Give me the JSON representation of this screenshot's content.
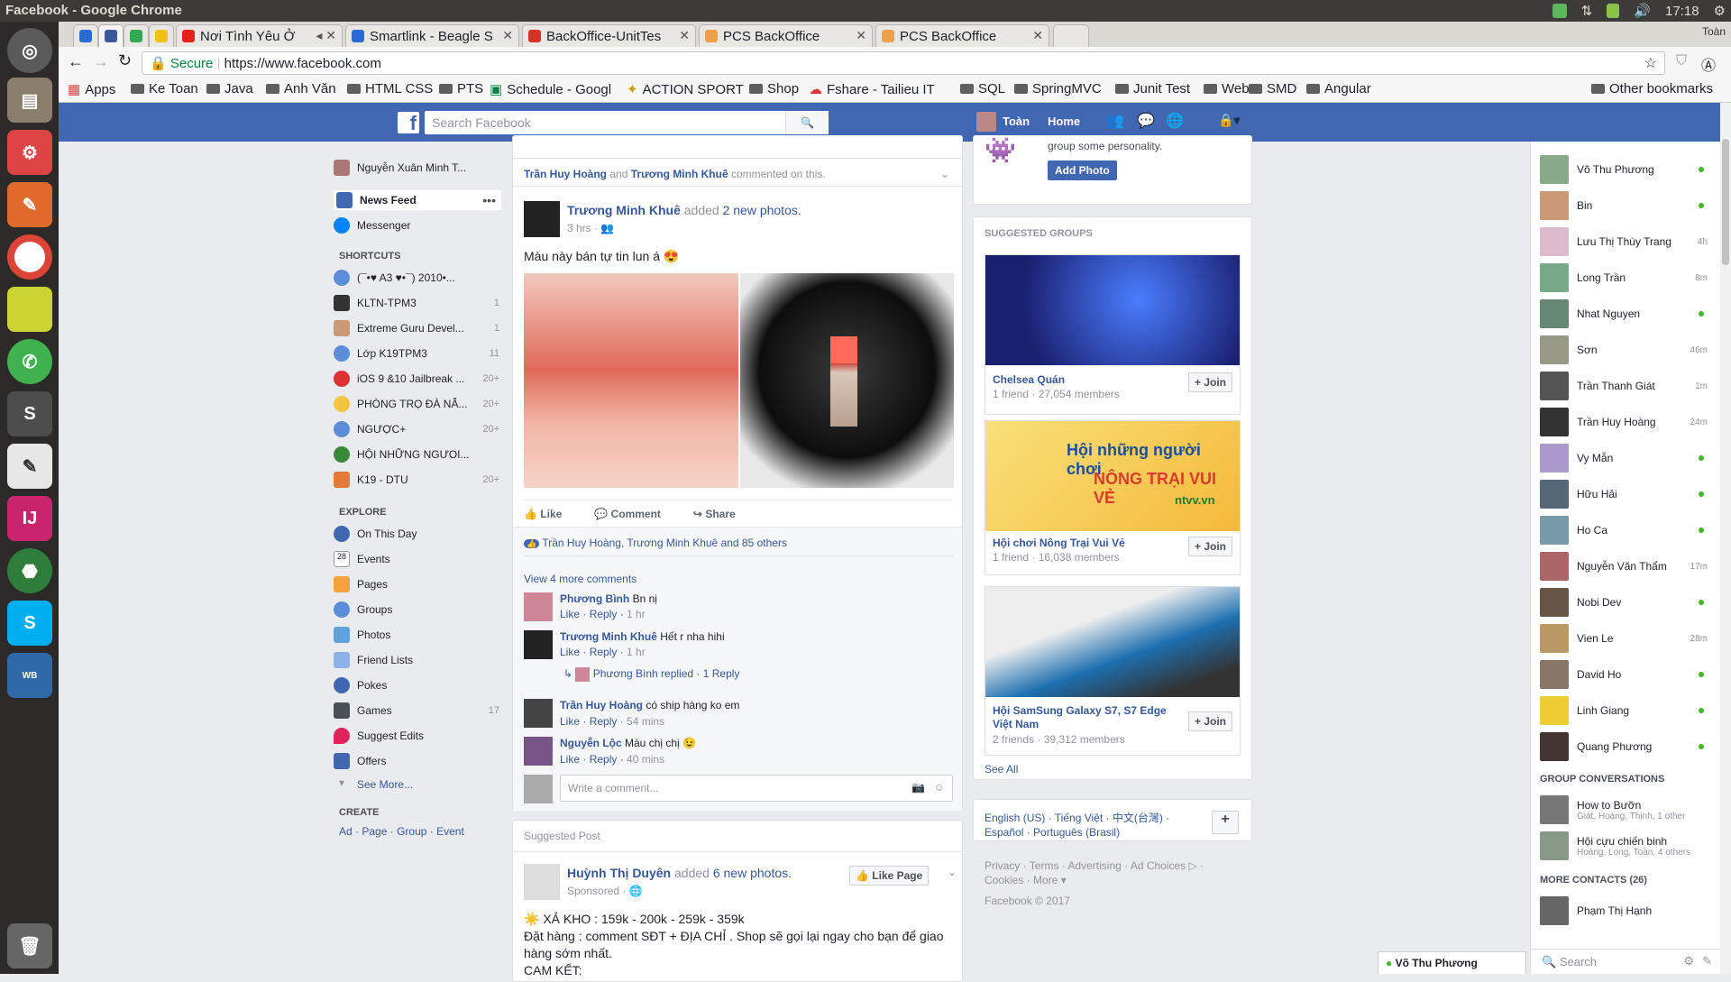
{
  "os": {
    "title": "Facebook - Google Chrome",
    "clock": "17:18",
    "user": "Toàn"
  },
  "tabs": [
    {
      "label": ""
    },
    {
      "label": ""
    },
    {
      "label": ""
    },
    {
      "label": ""
    },
    {
      "label": "Nơi Tình Yêu Ở"
    },
    {
      "label": "Smartlink - Beagle S"
    },
    {
      "label": "BackOffice-UnitTes"
    },
    {
      "label": "PCS BackOffice"
    },
    {
      "label": "PCS BackOffice"
    }
  ],
  "omnibox": {
    "secure": "Secure",
    "url": "https://www.facebook.com"
  },
  "bookmarks": [
    "Apps",
    "Ke Toan",
    "Java",
    "Anh Văn",
    "HTML CSS",
    "PTS",
    "Schedule - Googl",
    "ACTION SPORT",
    "Shop",
    "Fshare - Tailieu IT",
    "SQL",
    "SpringMVC",
    "Junit Test",
    "Web",
    "SMD",
    "Angular"
  ],
  "other_bookmarks": "Other bookmarks",
  "fb": {
    "search_placeholder": "Search Facebook",
    "user": "Toàn",
    "home": "Home"
  },
  "left": {
    "profile": "Nguyễn Xuân Minh T...",
    "newsfeed": "News Feed",
    "messenger": "Messenger",
    "shortcuts_title": "SHORTCUTS",
    "shortcuts": [
      {
        "label": "(¯•♥ A3 ♥•¯) 2010•...",
        "count": ""
      },
      {
        "label": "KLTN-TPM3",
        "count": "1"
      },
      {
        "label": "Extreme Guru Devel...",
        "count": "1"
      },
      {
        "label": "Lớp K19TPM3",
        "count": "11"
      },
      {
        "label": "iOS 9 &10 Jailbreak ...",
        "count": "20+"
      },
      {
        "label": "PHÒNG TRỌ ĐÀ NẴ...",
        "count": "20+"
      },
      {
        "label": "NGƯỢC+",
        "count": "20+"
      },
      {
        "label": "HỘI NHỮNG NGƯOI...",
        "count": ""
      },
      {
        "label": "K19 - DTU",
        "count": "20+"
      }
    ],
    "explore_title": "EXPLORE",
    "explore": [
      {
        "label": "On This Day",
        "count": ""
      },
      {
        "label": "Events",
        "count": ""
      },
      {
        "label": "Pages",
        "count": ""
      },
      {
        "label": "Groups",
        "count": ""
      },
      {
        "label": "Photos",
        "count": ""
      },
      {
        "label": "Friend Lists",
        "count": ""
      },
      {
        "label": "Pokes",
        "count": ""
      },
      {
        "label": "Games",
        "count": "17"
      },
      {
        "label": "Suggest Edits",
        "count": ""
      },
      {
        "label": "Offers",
        "count": ""
      },
      {
        "label": "See More...",
        "count": ""
      }
    ],
    "create_title": "CREATE",
    "create": [
      "Ad",
      "Page",
      "Group",
      "Event"
    ]
  },
  "post1": {
    "context_a": "Trần Huy Hoàng",
    "context_and": "and",
    "context_b": "Trương Minh Khuê",
    "context_rest": "commented on this.",
    "author": "Trương Minh Khuê",
    "action": "added",
    "action_link": "2 new photos.",
    "time": "3 hrs ·",
    "text": "Màu này bán tự tin lun á 😍",
    "like": "Like",
    "comment": "Comment",
    "share": "Share",
    "reactions": "Trần Huy Hoàng, Trương Minh Khuê and 85 others",
    "view_more": "View 4 more comments",
    "comments": [
      {
        "name": "Phương Bình",
        "text": "Bn nị",
        "time": "1 hr"
      },
      {
        "name": "Trương Minh Khuê",
        "text": "Hết r nha hihi",
        "time": "1 hr"
      },
      {
        "name": "Trần Huy Hoàng",
        "text": "có ship hàng ko em",
        "time": "54 mins"
      },
      {
        "name": "Nguyễn Lộc",
        "text": "Màu chị chị 😉",
        "time": "40 mins"
      }
    ],
    "reply_name": "Phương Bình",
    "reply_text": "replied · 1 Reply",
    "c_like": "Like",
    "c_reply": "Reply",
    "write": "Write a comment..."
  },
  "post2": {
    "label": "Suggested Post",
    "author": "Huỳnh Thị Duyên",
    "action": "added",
    "action_link": "6 new photos.",
    "sponsored": "Sponsored ·",
    "like_page": "Like Page",
    "line1": "☀️ XẢ KHO : 159k - 200k - 259k - 359k",
    "line2": "Đặt hàng : comment SĐT + ĐỊA CHỈ . Shop sẽ gọi lại ngay cho bạn để giao",
    "line3": "hàng sớm nhất.",
    "line4": "CAM KẾT:"
  },
  "rightmid": {
    "personality": "group some personality.",
    "add_photo": "Add Photo",
    "suggested_title": "SUGGESTED GROUPS",
    "groups": [
      {
        "name": "Chelsea Quán",
        "meta": "1 friend · 27,054 members",
        "join": "Join",
        "colors": [
          "#1a1f6e",
          "#4a7dff"
        ]
      },
      {
        "name": "Hội chơi Nông Trại Vui Vẻ",
        "meta": "1 friend · 16,038 members",
        "join": "Join",
        "colors": [
          "#f5c13a",
          "#d93b2f"
        ],
        "banner1": "Hội những người chơi",
        "banner2": "NÔNG TRẠI VUI VẺ",
        "banner3": "ntvv.vn"
      },
      {
        "name": "Hội SamSung Galaxy S7, S7 Edge Việt Nam",
        "meta": "2 friends · 39,312 members",
        "join": "Join",
        "colors": [
          "#e8e8e8",
          "#1d6fb0"
        ]
      }
    ],
    "see_all": "See All",
    "langs": "English (US) · Tiếng Việt · 中文(台灣) · Español · Português (Brasil)",
    "footer1": "Privacy · Terms · Advertising · Ad Choices ▷ ·",
    "footer2": "Cookies · More ▾",
    "copyright": "Facebook © 2017"
  },
  "chat": {
    "contacts": [
      {
        "name": "Võ Thu Phương",
        "status": "online",
        "time": ""
      },
      {
        "name": "Bin",
        "status": "online",
        "time": ""
      },
      {
        "name": "Lưu Thị Thùy Trang",
        "status": "away",
        "time": "4h"
      },
      {
        "name": "Long Trần",
        "status": "away",
        "time": "8m"
      },
      {
        "name": "Nhat Nguyen",
        "status": "online",
        "time": ""
      },
      {
        "name": "Sơn",
        "status": "away",
        "time": "46m"
      },
      {
        "name": "Trần Thanh Giát",
        "status": "away",
        "time": "1m"
      },
      {
        "name": "Trần Huy Hoàng",
        "status": "away",
        "time": "24m"
      },
      {
        "name": "Vy Mẫn",
        "status": "online",
        "time": ""
      },
      {
        "name": "Hữu Hải",
        "status": "online",
        "time": ""
      },
      {
        "name": "Ho Ca",
        "status": "online",
        "time": ""
      },
      {
        "name": "Nguyễn Văn Thẩm",
        "status": "away",
        "time": "17m"
      },
      {
        "name": "Nobi Dev",
        "status": "online",
        "time": ""
      },
      {
        "name": "Vien Le",
        "status": "away",
        "time": "28m"
      },
      {
        "name": "David Ho",
        "status": "online",
        "time": ""
      },
      {
        "name": "Linh Giang",
        "status": "online",
        "time": ""
      },
      {
        "name": "Quang Phương",
        "status": "online",
        "time": ""
      }
    ],
    "group_title": "GROUP CONVERSATIONS",
    "groups": [
      {
        "name": "How to Bưỡn",
        "sub": "Giát, Hoàng, Thịnh, 1 other"
      },
      {
        "name": "Hội cựu chiến binh",
        "sub": "Hoàng, Long, Toàn, 4 others"
      }
    ],
    "more_title": "MORE CONTACTS (26)",
    "more": [
      {
        "name": "Phạm Thị Hạnh"
      }
    ],
    "search": "Search",
    "open_chat": "Võ Thu Phương"
  }
}
